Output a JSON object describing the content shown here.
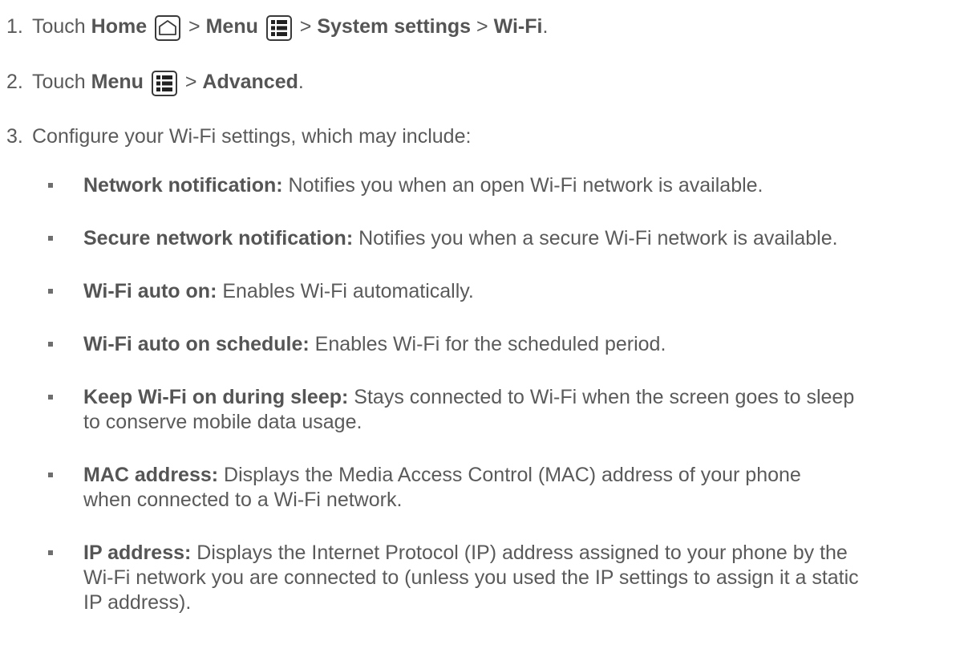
{
  "steps": [
    {
      "num": "1.",
      "pre": "Touch ",
      "home": "Home",
      "sep1": " > ",
      "menu": "Menu",
      "sep2": " > ",
      "system": "System settings",
      "sep3": " > ",
      "wifi": "Wi-Fi",
      "end": "."
    },
    {
      "num": "2.",
      "pre": "Touch ",
      "menu": "Menu",
      "sep1": " > ",
      "advanced": "Advanced",
      "end": "."
    },
    {
      "num": "3.",
      "text": "Configure your Wi-Fi settings, which may include:"
    }
  ],
  "options": [
    {
      "term": "Network notification:",
      "desc": " Notifies you when an open Wi-Fi network is available."
    },
    {
      "term": "Secure network notification:",
      "desc": " Notifies you when a secure Wi-Fi network is available."
    },
    {
      "term": "Wi-Fi auto on:",
      "desc": " Enables Wi-Fi automatically."
    },
    {
      "term": "Wi-Fi auto on schedule:",
      "desc": " Enables Wi-Fi for the scheduled period."
    },
    {
      "term": "Keep Wi-Fi on during sleep:",
      "desc": " Stays connected to Wi-Fi when the screen goes to sleep to conserve mobile data usage."
    },
    {
      "term": "MAC address:",
      "desc": " Displays the Media Access Control (MAC) address of your phone when connected to a Wi-Fi network."
    },
    {
      "term": "IP address:",
      "desc": " Displays the Internet Protocol (IP) address assigned to your phone by the Wi-Fi network you are connected to (unless you used the IP settings to assign it a static IP address)."
    }
  ],
  "icons": {
    "home": "home-icon",
    "menu": "menu-icon"
  },
  "colors": {
    "text": "#5a5a5a",
    "icon_stroke": "#3a3a3a",
    "bullet": "#6e6e6e"
  }
}
